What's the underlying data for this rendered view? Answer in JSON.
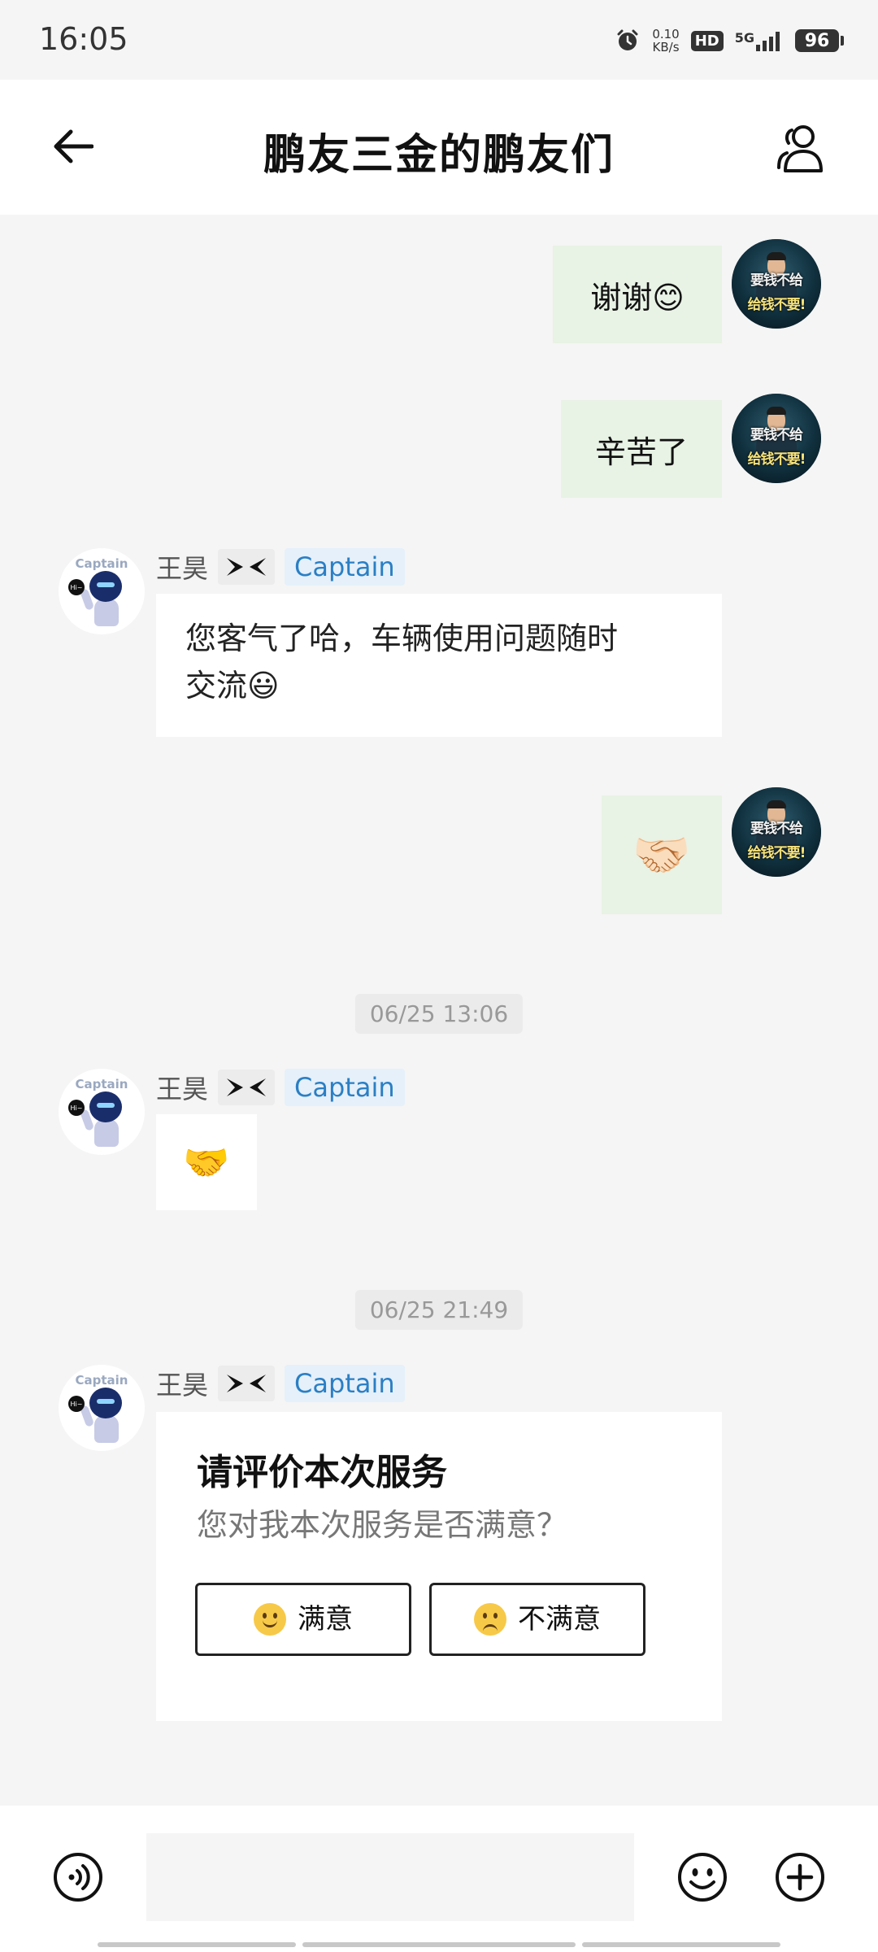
{
  "status_bar": {
    "time": "16:05",
    "net_speed_value": "0.10",
    "net_speed_unit": "KB/s",
    "hd": "HD",
    "network": "5G",
    "battery": "96"
  },
  "header": {
    "title": "鹏友三金的鹏友们"
  },
  "messages": {
    "m1": {
      "text": "谢谢😊"
    },
    "m2": {
      "text": "辛苦了"
    },
    "m3": {
      "sender": "王昊",
      "role": "Captain",
      "text_line1": "您客气了哈，车辆使用问题随时",
      "text_line2": "交流😃"
    },
    "m4": {
      "emoji": "🤝🏻"
    },
    "t1": "06/25 13:06",
    "m5": {
      "sender": "王昊",
      "role": "Captain",
      "emoji": "🤝"
    },
    "t2": "06/25 21:49",
    "m6": {
      "sender": "王昊",
      "role": "Captain",
      "title": "请评价本次服务",
      "subtitle": "您对我本次服务是否满意？",
      "satisfied_label": "满意",
      "unsatisfied_label": "不满意"
    },
    "avatar_self_text1": "要钱不给",
    "avatar_self_text2": "给钱不要!",
    "avatar_bot_text": "Captain",
    "avatar_bot_hi": "Hi~"
  },
  "input_bar": {
    "placeholder": ""
  },
  "icons": {
    "back": "arrow-left-icon",
    "members": "group-members-icon",
    "voice": "voice-icon",
    "emoji": "emoji-icon",
    "plus": "plus-icon",
    "brand": "xpeng-logo-icon"
  },
  "colors": {
    "outgoing_bubble": "#e8f2e5",
    "incoming_bubble": "#ffffff",
    "role_badge_text": "#2b7fc4",
    "role_badge_bg": "#e5f0fa",
    "background": "#f5f5f5"
  }
}
